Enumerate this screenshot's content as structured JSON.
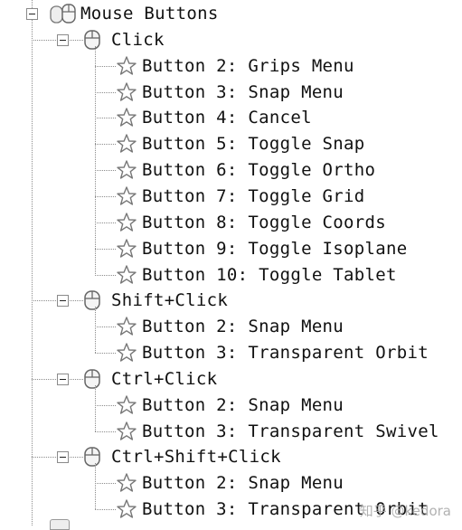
{
  "tree": {
    "root": {
      "label": "Mouse Buttons",
      "icon": "mouse-buttons-icon",
      "groups": [
        {
          "label": "Click",
          "icon": "mouse-icon",
          "items": [
            "Button 2: Grips Menu",
            "Button 3: Snap Menu",
            "Button 4: Cancel",
            "Button 5: Toggle Snap",
            "Button 6: Toggle Ortho",
            "Button 7: Toggle Grid",
            "Button 8: Toggle Coords",
            "Button 9: Toggle Isoplane",
            "Button 10: Toggle Tablet"
          ]
        },
        {
          "label": "Shift+Click",
          "icon": "mouse-icon",
          "items": [
            "Button 2: Snap Menu",
            "Button 3: Transparent Orbit"
          ]
        },
        {
          "label": "Ctrl+Click",
          "icon": "mouse-icon",
          "items": [
            "Button 2: Snap Menu",
            "Button 3: Transparent Swivel"
          ]
        },
        {
          "label": "Ctrl+Shift+Click",
          "icon": "mouse-icon",
          "items": [
            "Button 2: Snap Menu",
            "Button 3: Transparent Orbit"
          ]
        }
      ]
    },
    "item_icon": "star-icon",
    "expander_icon": "minus-expander-icon"
  },
  "watermark": "知乎 @kedora",
  "colors": {
    "tree_line": "#8c8c8c",
    "text": "#111111",
    "star_stroke": "#777777",
    "mouse_stroke": "#666666"
  }
}
